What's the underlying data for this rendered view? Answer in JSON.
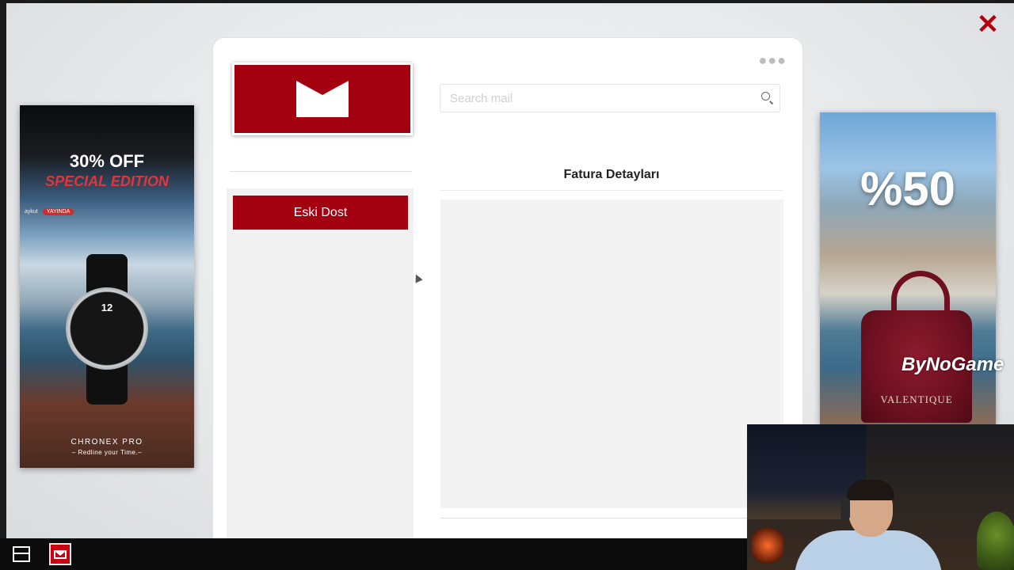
{
  "ads": {
    "left": {
      "headline": "30% OFF",
      "subheadline": "SPECIAL EDITION",
      "streamer_user": "aykut",
      "live_badge": "YAYINDA",
      "dial_number": "12",
      "brand": "CHRONEX PRO",
      "slogan": "– Redline your Time.–"
    },
    "right": {
      "headline": "%50",
      "product_label": "VALENTIQUE"
    }
  },
  "watermark": "ByNoGame",
  "mail": {
    "search_placeholder": "Search mail",
    "folders": [
      {
        "label": "Eski Dost"
      }
    ],
    "selected_mail_subject": "Fatura Detayları"
  },
  "colors": {
    "accent": "#a30010",
    "close": "#b3000f",
    "taskbar": "#0c0c0c"
  },
  "icons": {
    "window_close": "close-icon",
    "app_logo": "envelope-icon",
    "search": "search-icon",
    "more": "more-dots-icon",
    "taskbar_menu": "menu-icon",
    "taskbar_mail": "mail-app-icon"
  }
}
